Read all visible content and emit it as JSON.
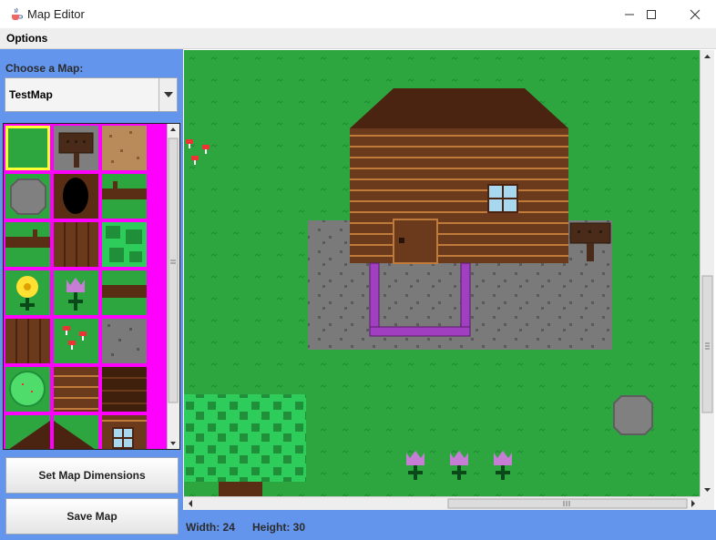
{
  "window": {
    "title": "Map Editor",
    "icon": "java-coffee-icon"
  },
  "menu": {
    "items": [
      "Options"
    ]
  },
  "left_panel": {
    "choose_label": "Choose a Map:",
    "map_select": {
      "selected": "TestMap"
    },
    "palette": {
      "tiles": [
        "grass",
        "sign",
        "dirt",
        "rock",
        "tree-trunk-hole",
        "log-horizontal",
        "log-horizontal",
        "wood-planks-vertical",
        "bush-leaves",
        "yellow-flower",
        "purple-flower",
        "log-horizontal",
        "wood-planks-vertical",
        "mushrooms",
        "stone",
        "round-bush",
        "wood-wall",
        "dark-wood-wall",
        "roof",
        "roof",
        "house-window"
      ],
      "selected_index": 0
    },
    "buttons": {
      "set_dimensions": "Set Map Dimensions",
      "save": "Save Map"
    }
  },
  "status": {
    "width": "Width: 24",
    "height": "Height: 30"
  },
  "colors": {
    "panel_blue": "#6495ed",
    "grass": "#2ea63f",
    "palette_bg": "#ff00ff",
    "selection": "#ffff33"
  }
}
